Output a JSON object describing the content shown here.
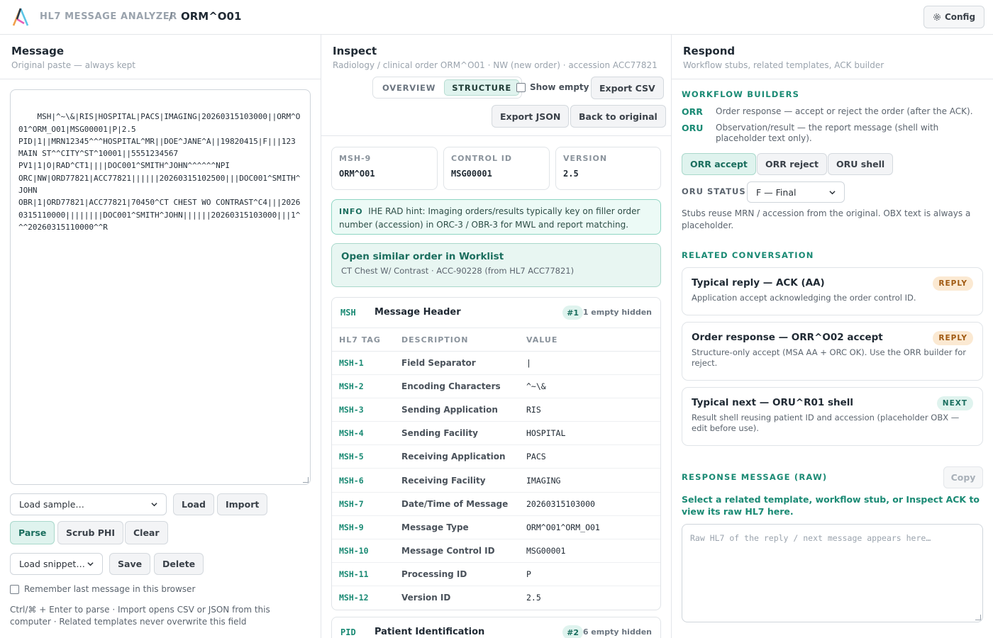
{
  "header": {
    "app_name": "HL7 MESSAGE ANALYZER",
    "separator": "/",
    "current": "ORM^O01",
    "config_label": "Config"
  },
  "message_panel": {
    "title": "Message",
    "subtitle": "Original paste — always kept",
    "raw": "MSH|^~\\&|RIS|HOSPITAL|PACS|IMAGING|20260315103000||ORM^O01^ORM_O01|MSG00001|P|2.5\nPID|1||MRN12345^^^HOSPITAL^MR||DOE^JANE^A||19820415|F|||123 MAIN ST^^CITY^ST^10001||5551234567\nPV1|1|O|RAD^CT1||||DOC001^SMITH^JOHN^^^^^^NPI\nORC|NW|ORD77821|ACC77821||||||20260315102500|||DOC001^SMITH^JOHN\nOBR|1|ORD77821|ACC77821|70450^CT CHEST WO CONTRAST^C4|||20260315110000||||||||DOC001^SMITH^JOHN||||||20260315103000|||1^^^20260315110000^^R",
    "sample_select": "Load sample…",
    "load_label": "Load",
    "import_label": "Import",
    "parse_label": "Parse",
    "scrub_label": "Scrub PHI",
    "clear_label": "Clear",
    "snippet_select": "Load snippet…",
    "save_label": "Save",
    "delete_label": "Delete",
    "remember_label": "Remember last message in this browser",
    "hint": "Ctrl/⌘ + Enter to parse · Import opens CSV or JSON from this computer · Related templates never overwrite this field"
  },
  "inspect_panel": {
    "title": "Inspect",
    "subtitle": "Radiology / clinical order ORM^O01 · NW (new order) · accession ACC77821",
    "tabs": [
      "OVERVIEW",
      "STRUCTURE"
    ],
    "active_tab": "STRUCTURE",
    "show_empty_label": "Show empty",
    "export_csv": "Export CSV",
    "export_json": "Export JSON",
    "back_label": "Back to original",
    "meta": [
      {
        "label": "MSH-9",
        "value": "ORM^O01"
      },
      {
        "label": "CONTROL ID",
        "value": "MSG00001"
      },
      {
        "label": "VERSION",
        "value": "2.5"
      }
    ],
    "info_tag": "INFO",
    "info_text": "IHE RAD hint: Imaging orders/results typically key on filler order number (accession) in ORC-3 / OBR-3 for MWL and report matching.",
    "worklist_title": "Open similar order in Worklist",
    "worklist_sub": "CT Chest W/ Contrast · ACC-90228 (from HL7 ACC77821)",
    "segments": [
      {
        "code": "MSH",
        "name": "Message Header",
        "num": "#1",
        "empty_hidden": "1 empty hidden",
        "columns": [
          "HL7 TAG",
          "DESCRIPTION",
          "VALUE"
        ],
        "rows": [
          {
            "tag": "MSH-1",
            "desc": "Field Separator",
            "value": "|"
          },
          {
            "tag": "MSH-2",
            "desc": "Encoding Characters",
            "value": "^~\\&"
          },
          {
            "tag": "MSH-3",
            "desc": "Sending Application",
            "value": "RIS"
          },
          {
            "tag": "MSH-4",
            "desc": "Sending Facility",
            "value": "HOSPITAL"
          },
          {
            "tag": "MSH-5",
            "desc": "Receiving Application",
            "value": "PACS"
          },
          {
            "tag": "MSH-6",
            "desc": "Receiving Facility",
            "value": "IMAGING"
          },
          {
            "tag": "MSH-7",
            "desc": "Date/Time of Message",
            "value": "20260315103000"
          },
          {
            "tag": "MSH-9",
            "desc": "Message Type",
            "value": "ORM^O01^ORM_O01"
          },
          {
            "tag": "MSH-10",
            "desc": "Message Control ID",
            "value": "MSG00001"
          },
          {
            "tag": "MSH-11",
            "desc": "Processing ID",
            "value": "P"
          },
          {
            "tag": "MSH-12",
            "desc": "Version ID",
            "value": "2.5"
          }
        ]
      },
      {
        "code": "PID",
        "name": "Patient Identification",
        "num": "#2",
        "empty_hidden": "6 empty hidden"
      }
    ]
  },
  "respond_panel": {
    "title": "Respond",
    "subtitle": "Workflow stubs, related templates, ACK builder",
    "workflow_label": "WORKFLOW BUILDERS",
    "workflows": [
      {
        "key": "ORR",
        "text": "Order response — accept or reject the order (after the ACK)."
      },
      {
        "key": "ORU",
        "text": "Observation/result — the report message (shell with placeholder text only)."
      }
    ],
    "orr_accept": "ORR accept",
    "orr_reject": "ORR reject",
    "oru_shell": "ORU shell",
    "oru_status_label": "ORU STATUS",
    "oru_status_value": "F — Final",
    "stub_note": "Stubs reuse MRN / accession from the original. OBX text is always a placeholder.",
    "related_label": "RELATED CONVERSATION",
    "related": [
      {
        "title": "Typical reply — ACK (AA)",
        "desc": "Application accept acknowledging the order control ID.",
        "tag": "REPLY"
      },
      {
        "title": "Order response — ORR^O02 accept",
        "desc": "Structure-only accept (MSA AA + ORC OK). Use the ORR builder for reject.",
        "tag": "REPLY"
      },
      {
        "title": "Typical next — ORU^R01 shell",
        "desc": "Result shell reusing patient ID and accession (placeholder OBX — edit before use).",
        "tag": "NEXT"
      }
    ],
    "response_label": "RESPONSE MESSAGE (RAW)",
    "copy_label": "Copy",
    "response_hint": "Select a related template, workflow stub, or Inspect ACK to view its raw HL7 here.",
    "response_placeholder": "Raw HL7 of the reply / next message appears here…"
  }
}
